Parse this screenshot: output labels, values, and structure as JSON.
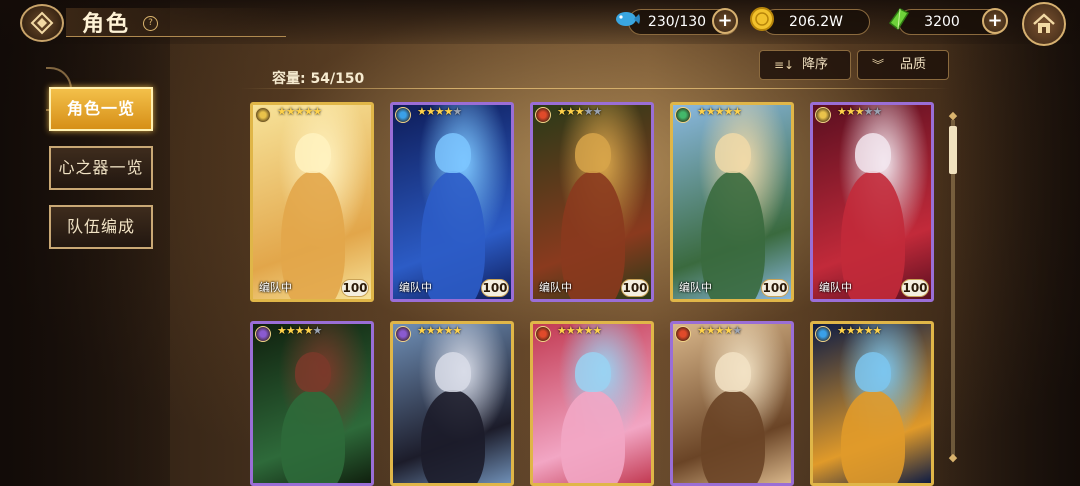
{
  "header": {
    "title": "角色",
    "help_symbol": "?",
    "stamina": "230/130",
    "gold": "206.2W",
    "gems": "3200",
    "plus_symbol": "+"
  },
  "sidebar": {
    "items": [
      {
        "label": "角色一览",
        "active": true
      },
      {
        "label": "心之器一览",
        "active": false
      },
      {
        "label": "队伍编成",
        "active": false
      }
    ]
  },
  "toolbar": {
    "capacity": "容量: 54/150",
    "sort_order_label": "降序",
    "sort_order_icon": "≡↓",
    "filter_label": "品质",
    "filter_icon": "︾"
  },
  "cards": [
    {
      "element": "light",
      "element_color": "#e9c24a",
      "stars": 5,
      "max_stars": 5,
      "tag": "编队中",
      "level": "100",
      "frame": "gold",
      "palette": [
        "#f7e39a",
        "#e2a64a",
        "#fff2c0"
      ]
    },
    {
      "element": "water",
      "element_color": "#3aa0e8",
      "stars": 4,
      "max_stars": 5,
      "tag": "编队中",
      "level": "100",
      "frame": "purple",
      "palette": [
        "#0e1c58",
        "#2c5cc6",
        "#7cc6ff"
      ]
    },
    {
      "element": "fire",
      "element_color": "#e04a2a",
      "stars": 3,
      "max_stars": 5,
      "tag": "编队中",
      "level": "100",
      "frame": "purple",
      "palette": [
        "#2a3a18",
        "#8a3a1e",
        "#d7a44a"
      ]
    },
    {
      "element": "wind",
      "element_color": "#43b86a",
      "stars": 5,
      "max_stars": 5,
      "tag": "编队中",
      "level": "100",
      "frame": "gold",
      "palette": [
        "#8ab8e0",
        "#3a6a3e",
        "#f0d9a8"
      ]
    },
    {
      "element": "light",
      "element_color": "#e9c24a",
      "stars": 3,
      "max_stars": 5,
      "tag": "编队中",
      "level": "100",
      "frame": "purple",
      "palette": [
        "#5a0f20",
        "#c22a3a",
        "#f2e6ee"
      ]
    },
    {
      "element": "dark",
      "element_color": "#8a5ad0",
      "stars": 4,
      "max_stars": 5,
      "tag": "",
      "level": "",
      "frame": "purple",
      "palette": [
        "#10200e",
        "#2e6a3a",
        "#7a3a2a"
      ]
    },
    {
      "element": "dark",
      "element_color": "#8a5ad0",
      "stars": 5,
      "max_stars": 5,
      "tag": "",
      "level": "",
      "frame": "gold",
      "palette": [
        "#6f8fb6",
        "#1c1c2a",
        "#d8dce8"
      ]
    },
    {
      "element": "fire",
      "element_color": "#e04a2a",
      "stars": 5,
      "max_stars": 5,
      "tag": "",
      "level": "",
      "frame": "gold",
      "palette": [
        "#c23a52",
        "#f2a6c4",
        "#9ad2f2"
      ]
    },
    {
      "element": "fire",
      "element_color": "#e04a2a",
      "stars": 4,
      "max_stars": 5,
      "tag": "",
      "level": "",
      "frame": "purple",
      "palette": [
        "#d8b68a",
        "#6a4426",
        "#f2e2c4"
      ]
    },
    {
      "element": "water",
      "element_color": "#3aa0e8",
      "stars": 5,
      "max_stars": 5,
      "tag": "",
      "level": "",
      "frame": "gold",
      "palette": [
        "#0e1c44",
        "#e09a2a",
        "#7cc6ee"
      ]
    }
  ],
  "scroll": {
    "up_symbol": "◆",
    "down_symbol": "◆"
  }
}
